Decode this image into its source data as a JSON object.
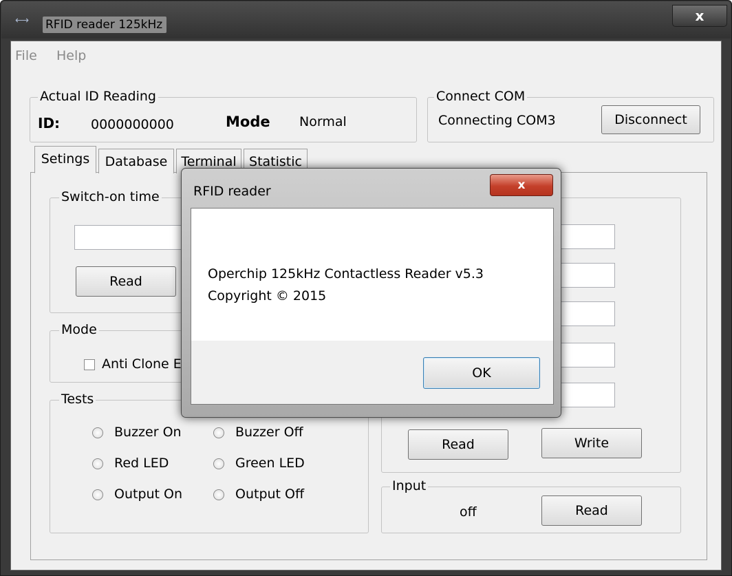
{
  "window": {
    "title": "RFID reader 125kHz",
    "close_label": "x"
  },
  "menu": {
    "file": "File",
    "help": "Help"
  },
  "actual_id": {
    "legend": "Actual ID Reading",
    "id_label": "ID:",
    "id_value": "0000000000",
    "mode_label": "Mode",
    "mode_value": "Normal"
  },
  "connect_com": {
    "legend": "Connect COM",
    "status": "Connecting COM3",
    "button": "Disconnect"
  },
  "tabs": [
    {
      "label": "Setings",
      "selected": true
    },
    {
      "label": "Database",
      "selected": false
    },
    {
      "label": "Terminal",
      "selected": false
    },
    {
      "label": "Statistic",
      "selected": false
    }
  ],
  "switch_on_time": {
    "legend": "Switch-on time",
    "input_value": "",
    "read_button": "Read"
  },
  "mode_group": {
    "legend": "Mode",
    "checkbox_label": "Anti Clone E",
    "checked": false
  },
  "tests": {
    "legend": "Tests",
    "options": [
      "Buzzer On",
      "Buzzer Off",
      "Red LED",
      "Green LED",
      "Output On",
      "Output Off"
    ]
  },
  "right_group": {
    "fields": [
      "",
      "",
      "",
      "",
      ""
    ],
    "read_button": "Read",
    "write_button": "Write"
  },
  "input_group": {
    "legend": "Input",
    "value": "off",
    "read_button": "Read"
  },
  "dialog": {
    "title": "RFID reader",
    "close_label": "x",
    "line1": "Operchip 125kHz Contactless Reader v5.3",
    "line2": "Copyright © 2015",
    "ok_button": "OK"
  },
  "colors": {
    "titlebar": "#3a3a3a",
    "client_bg": "#f0f0f0",
    "dialog_close": "#c4402a"
  }
}
